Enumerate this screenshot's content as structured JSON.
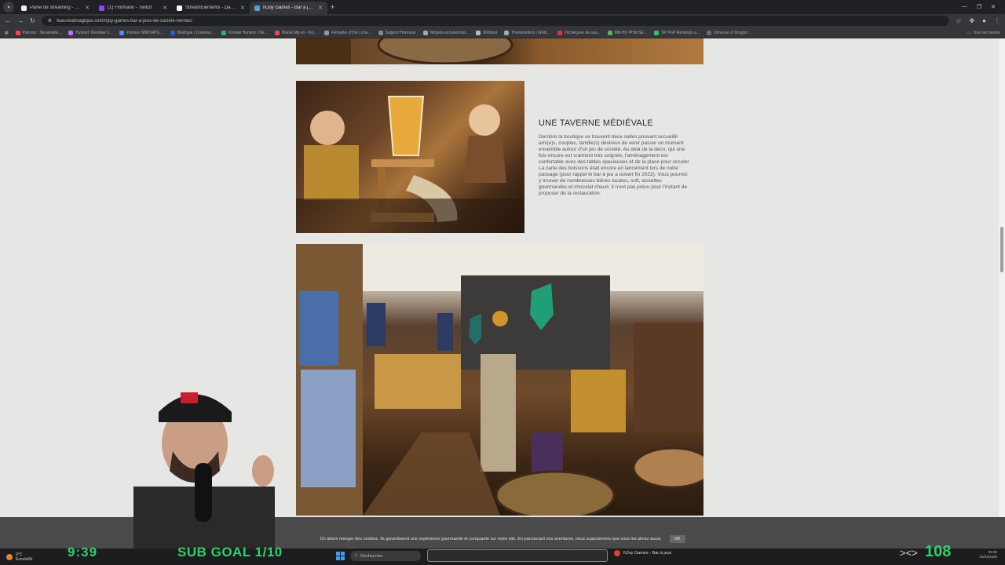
{
  "browser": {
    "tabs": [
      {
        "label": "Panel de streaming - Wise.Bui",
        "color": "#f0f0f0"
      },
      {
        "label": "(1) Flormann - Twitch",
        "color": "#9146ff"
      },
      {
        "label": "StreamElements - Dashboard",
        "color": "#ffffff"
      },
      {
        "label": "NJoy Games - Bar à jeux de so",
        "color": "#4fa3d9"
      }
    ],
    "url": "leauvivalmagique.com/njoy-games-bar-a-jeux-de-societe-rennes/",
    "bookmarks": [
      {
        "label": "Patreon : Streamelle...",
        "color": "#ff424d"
      },
      {
        "label": "Hypixel: Dévoilee 1...",
        "color": "#c070ff"
      },
      {
        "label": "Patreon MMORPG...",
        "color": "#4e8cf5"
      },
      {
        "label": "Warhype | Createur...",
        "color": "#2d5bd7"
      },
      {
        "label": "Knowle Hunters | Ne...",
        "color": "#32b36a"
      },
      {
        "label": "Planet Mg en - Kry...",
        "color": "#e84b4b"
      },
      {
        "label": "Remarks of the Lone...",
        "color": "#999999"
      },
      {
        "label": "Support Hermeus",
        "color": "#888888"
      },
      {
        "label": "Nirgalcoucoulecosta...",
        "color": "#aaaaaa"
      },
      {
        "label": "Shitpost",
        "color": "#bbbbbb"
      },
      {
        "label": "Thrownsiders | Webl...",
        "color": "#aaaaaa"
      },
      {
        "label": "Vitchergeur de sau...",
        "color": "#d63b3b"
      },
      {
        "label": "MB-HO PHM SE...",
        "color": "#59b35f"
      },
      {
        "label": "SFI PvP Rankings a...",
        "color": "#35c46d"
      },
      {
        "label": "Universe of Dragon...",
        "color": "#6b6b6b"
      }
    ],
    "bookmarks_folder": "Tous les favoris"
  },
  "article": {
    "title": "UNE TAVERNE MÉDIÉVALE",
    "body": "Derrière la boutique se trouvent deux salles pouvant accueillir ami(e)s, couples, famille(s) désireux de venir passer un moment ensemble autour d'un jeu de société. Au delà de la déco, qui une fois encore est vraiment très soignée, l'aménagement est confortable avec des tables spacieuses et de la place pour circuler. La carte des boissons était encore en lancement lors de notre passage (pour rappel le bar à jeu a ouvert fin 2023). Vous pourrez y trouver de nombreuses bières locales, soft, assiettes gourmandes et chocolat chaud. Il n'est pas prévu pour l'instant de proposer de la restauration."
  },
  "cookie": {
    "text": "On adore manger des cookies. Ils garantissent une expérience gourmande et conquante sur notre site. En parcourant nos aventures, nous supposerons que vous les aimez aussi.",
    "ok_label": "OK"
  },
  "overlay": {
    "timer": "9:39",
    "sub_goal": "SUB GOAL 1/10",
    "count": "108"
  },
  "taskbar": {
    "weather_temp": "9°C",
    "weather_desc": "Ensoleillé",
    "search_placeholder": "Rechercher",
    "active_window": "NJoy Games - Bar à jeux",
    "time": "09:39",
    "date": "04/03/2026"
  }
}
